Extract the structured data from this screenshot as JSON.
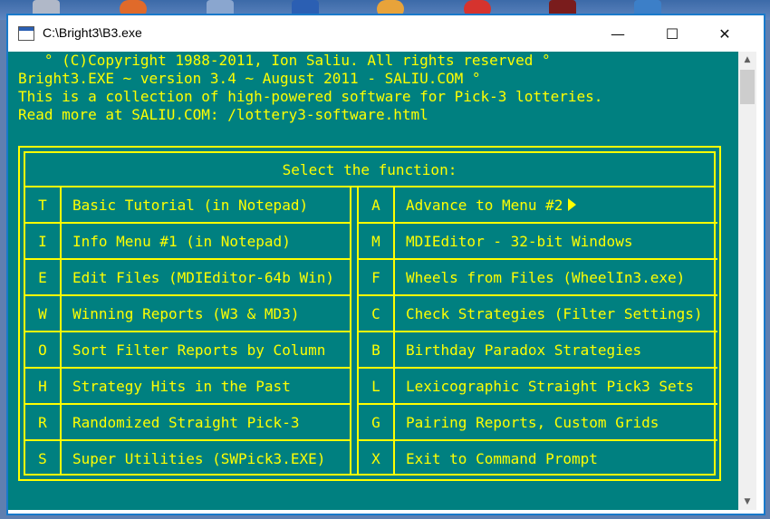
{
  "window": {
    "title": "C:\\Bright3\\B3.exe",
    "minimize_glyph": "—",
    "maximize_glyph": "☐",
    "close_glyph": "✕"
  },
  "header": {
    "lines": [
      "   ° (C)Copyright 1988-2011, Ion Saliu. All rights reserved °",
      "Bright3.EXE ~ version 3.4 ~ August 2011 - SALIU.COM °",
      "This is a collection of high-powered software for Pick-3 lotteries.",
      "Read more at SALIU.COM: /lottery3-software.html"
    ]
  },
  "menu": {
    "title": "Select the function:",
    "left": [
      {
        "key": "T",
        "label": "Basic Tutorial (in Notepad)"
      },
      {
        "key": "I",
        "label": "Info Menu #1 (in Notepad)"
      },
      {
        "key": "E",
        "label": "Edit Files (MDIEditor-64b Win)"
      },
      {
        "key": "W",
        "label": "Winning Reports (W3 & MD3)"
      },
      {
        "key": "O",
        "label": "Sort Filter Reports by Column"
      },
      {
        "key": "H",
        "label": "Strategy Hits in the Past"
      },
      {
        "key": "R",
        "label": "Randomized Straight Pick-3"
      },
      {
        "key": "S",
        "label": "Super Utilities (SWPick3.EXE)"
      }
    ],
    "right": [
      {
        "key": "A",
        "label": "Advance to Menu #2"
      },
      {
        "key": "M",
        "label": "MDIEditor - 32-bit Windows"
      },
      {
        "key": "F",
        "label": "Wheels from Files (WheelIn3.exe)"
      },
      {
        "key": "C",
        "label": "Check Strategies (Filter Settings)"
      },
      {
        "key": "B",
        "label": "Birthday Paradox Strategies"
      },
      {
        "key": "L",
        "label": "Lexicographic Straight Pick3 Sets"
      },
      {
        "key": "G",
        "label": "Pairing Reports, Custom Grids"
      },
      {
        "key": "X",
        "label": "Exit to Command Prompt"
      }
    ]
  },
  "scrollbar": {
    "up_glyph": "▲",
    "down_glyph": "▼"
  },
  "colors": {
    "console_bg": "#008080",
    "console_text": "#ffff00",
    "window_border": "#1979ca"
  },
  "icons": {
    "app": "console-app-icon",
    "advance": "triangle-right-icon"
  }
}
